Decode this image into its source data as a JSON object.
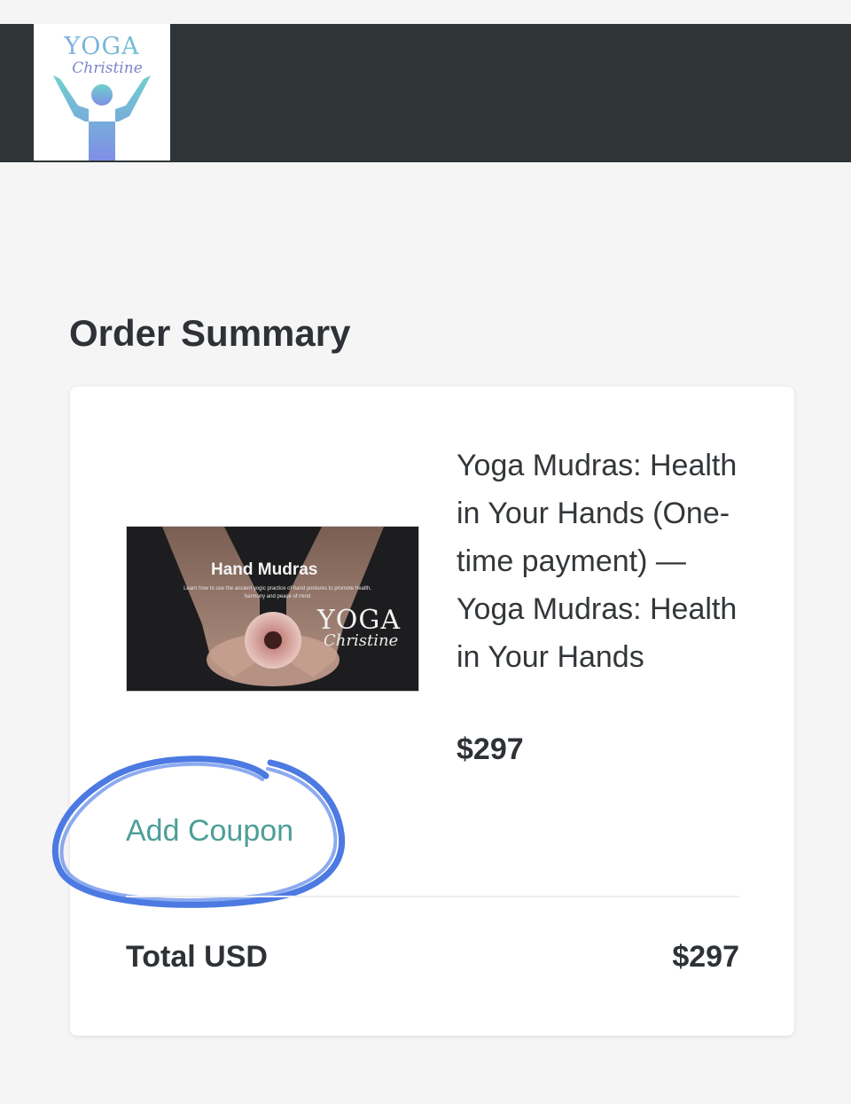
{
  "header": {
    "logo": {
      "wordmark": "YOGA",
      "script": "Christine"
    }
  },
  "order_summary": {
    "title": "Order Summary",
    "item": {
      "thumbnail": {
        "title": "Hand Mudras",
        "subtitle": "Learn how to use the ancient yogic practice of hand postures to promote health, harmony and peace of mind",
        "logo_word": "YOGA",
        "logo_script": "Christine"
      },
      "name": "Yoga Mudras: Health in Your Hands (One-time payment) — Yoga Mudras: Health in Your Hands",
      "price": "$297"
    },
    "coupon_label": "Add Coupon",
    "total_label": "Total USD",
    "total_value": "$297"
  },
  "colors": {
    "header_bg": "#2f3437",
    "page_bg": "#f5f5f6",
    "link": "#4d9e98",
    "scribble": "#3d6fe0"
  }
}
